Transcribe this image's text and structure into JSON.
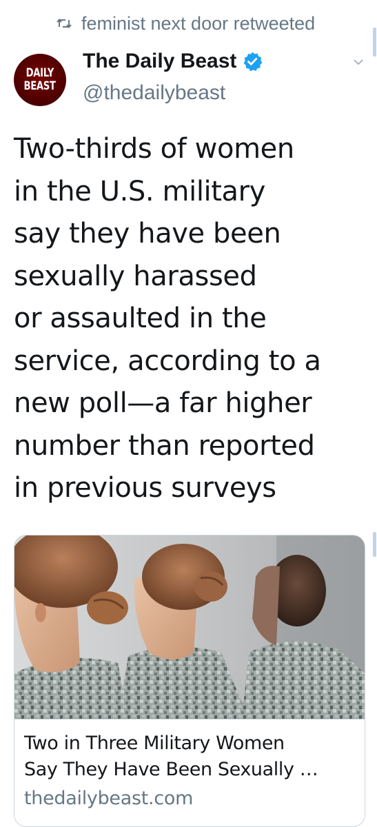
{
  "retweet": {
    "icon": "retweet-icon",
    "text": "feminist next door retweeted"
  },
  "author": {
    "avatar_lines": [
      "DAILY",
      "BEAST"
    ],
    "name": "The Daily Beast",
    "handle": "@thedailybeast",
    "verified_icon": "verified-badge-icon",
    "brand_color": "#1da1f2"
  },
  "menu": {
    "icon": "chevron-down-icon"
  },
  "tweet": {
    "lines": [
      "Two-thirds of women",
      "in the U.S. military",
      "say they have been",
      "sexually harassed",
      "or assaulted in the",
      "service, according to a",
      "new poll—a far higher",
      "number than reported",
      "in previous surveys"
    ]
  },
  "card": {
    "image_icon": "article-photo",
    "title_lines": [
      "Two in Three Military Women",
      "Say They Have Been Sexually …"
    ],
    "domain": "thedailybeast.com"
  },
  "colors": {
    "text": "#14171a",
    "muted": "#657786",
    "border": "#ccd6dd",
    "scrollbar": "#bcd6ee"
  }
}
